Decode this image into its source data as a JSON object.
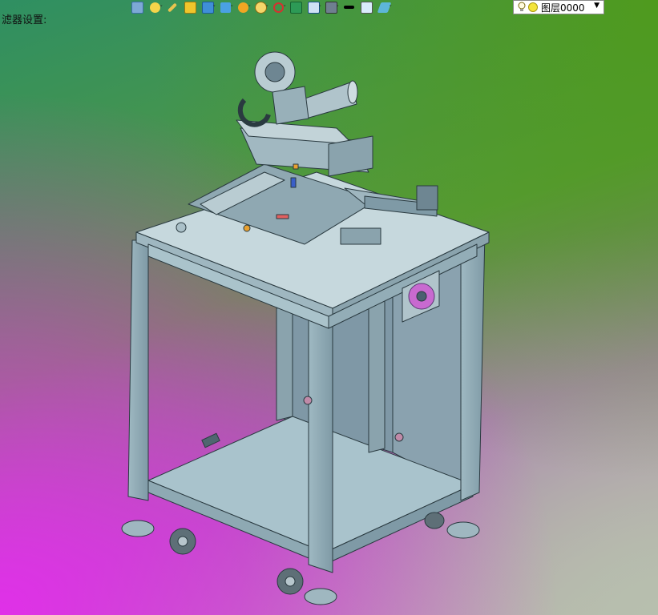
{
  "status_text": "滤器设置:",
  "layer": {
    "name": "图层0000"
  },
  "colors": {
    "background_top_right": "#4f9a1e",
    "background_bottom_left": "#e030e8",
    "model_steel": "#9fb9c2",
    "layer_dot": "#f3e43a"
  },
  "toolbar_icons": [
    "sketch-icon",
    "point-tool-icon",
    "pencil-icon",
    "eraser-icon",
    "solid-cube-icon",
    "surface-icon",
    "render-style-icon",
    "zoom-icon",
    "axis-icon",
    "fit-all-icon",
    "view-orientation-icon",
    "display-icon",
    "line-weight-icon",
    "color-swatch-icon",
    "layer-stack-icon"
  ]
}
